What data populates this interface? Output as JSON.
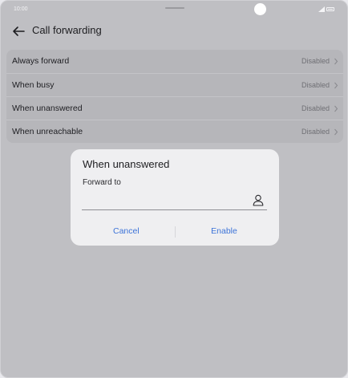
{
  "status_bar": {
    "time": "10:00",
    "icons": [
      "signal-icon",
      "battery-icon"
    ]
  },
  "app_bar": {
    "back_icon": "arrow-left-icon",
    "title": "Call forwarding"
  },
  "forwarding_options": [
    {
      "label": "Always forward",
      "status": "Disabled"
    },
    {
      "label": "When busy",
      "status": "Disabled"
    },
    {
      "label": "When unanswered",
      "status": "Disabled"
    },
    {
      "label": "When unreachable",
      "status": "Disabled"
    }
  ],
  "dialog": {
    "title": "When unanswered",
    "field_label": "Forward to",
    "field_value": "",
    "contact_icon": "person-icon",
    "cancel_label": "Cancel",
    "enable_label": "Enable"
  },
  "colors": {
    "accent": "#3c73d8",
    "screen_background": "#bfbfc3",
    "dialog_background": "#efeff1"
  }
}
